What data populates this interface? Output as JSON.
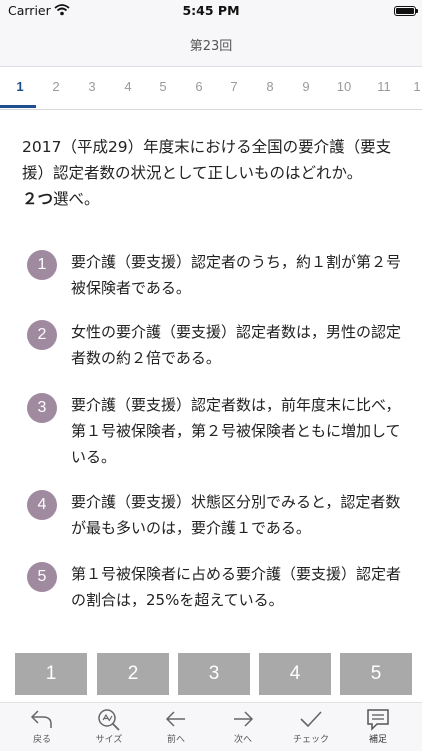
{
  "status_bar": {
    "carrier": "Carrier",
    "time": "5:45 PM"
  },
  "nav": {
    "title": "第23回"
  },
  "tabs": [
    "1",
    "2",
    "3",
    "4",
    "5",
    "6",
    "7",
    "8",
    "9",
    "10",
    "11",
    "1"
  ],
  "question": {
    "text_before": "2017（平成29）年度末における全国の要介護（要支援）認定者数の状況として正しいものはどれか。",
    "emphasis": "２つ",
    "text_after": "選べ。"
  },
  "choices": [
    {
      "num": "1",
      "text": "要介護（要支援）認定者のうち，約１割が第２号被保険者である。"
    },
    {
      "num": "2",
      "text": "女性の要介護（要支援）認定者数は，男性の認定者数の約２倍である。"
    },
    {
      "num": "3",
      "text": "要介護（要支援）認定者数は，前年度末に比べ，第１号被保険者，第２号被保険者ともに増加している。"
    },
    {
      "num": "4",
      "text": "要介護（要支援）状態区分別でみると，認定者数が最も多いのは，要介護１である。"
    },
    {
      "num": "5",
      "text": "第１号被保険者に占める要介護（要支援）認定者の割合は，25%を超えている。"
    }
  ],
  "answer_buttons": [
    "1",
    "2",
    "3",
    "4",
    "5"
  ],
  "toolbar": {
    "back": "戻る",
    "size": "サイズ",
    "prev": "前へ",
    "next": "次へ",
    "check": "チェック",
    "note": "補足"
  },
  "colors": {
    "accent": "#1f4f8f",
    "choice_circle": "#a08aa0",
    "answer_button": "#a9a9a9"
  }
}
